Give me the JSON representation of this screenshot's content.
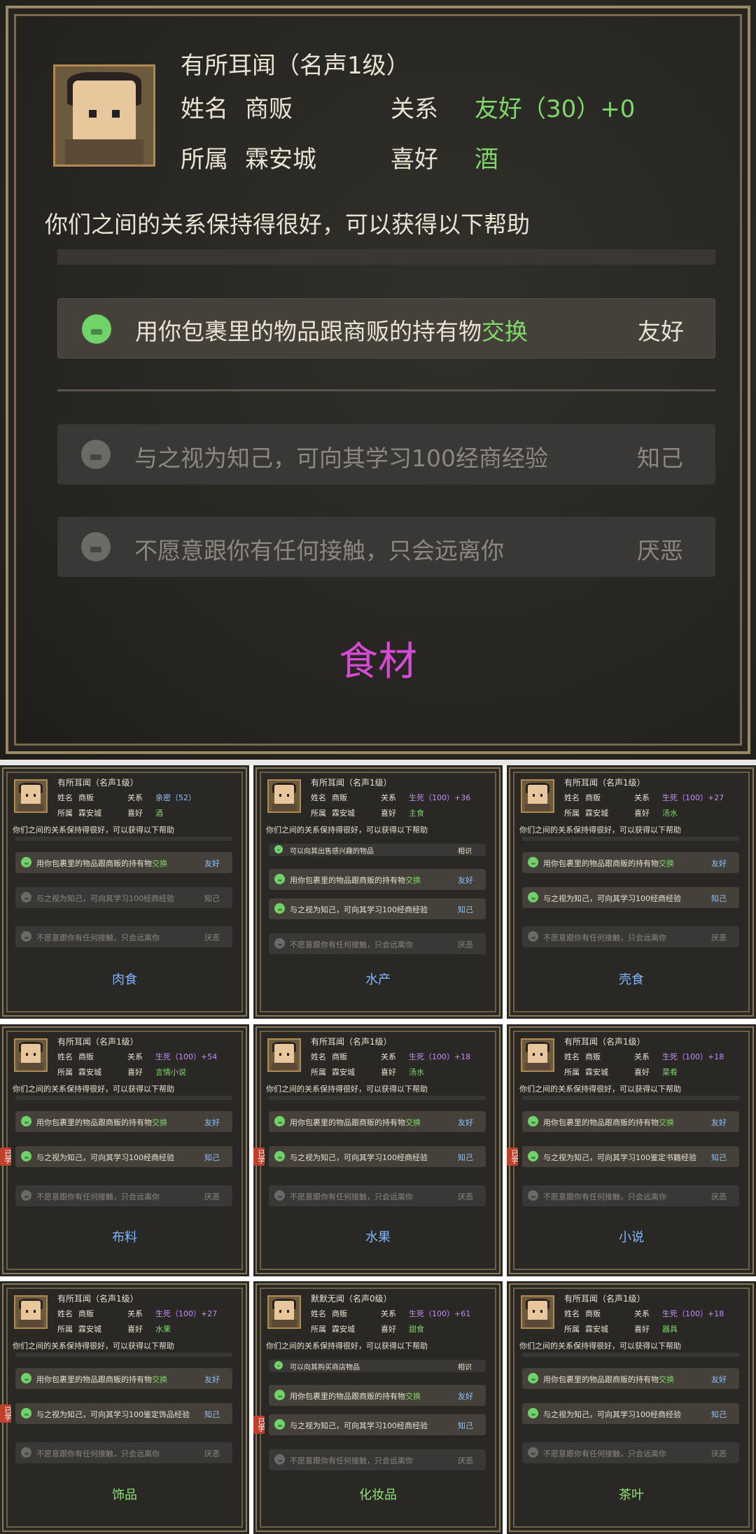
{
  "main": {
    "title": "有所耳闻（名声1级）",
    "name_label": "姓名",
    "name": "商贩",
    "relation_label": "关系",
    "relation": "友好（30）+0",
    "belong_label": "所属",
    "belong": "霖安城",
    "like_label": "喜好",
    "like": "酒",
    "intro": "你们之间的关系保持得很好，可以获得以下帮助",
    "rows": [
      {
        "text_a": "用你包裹里的物品跟商贩的持有物",
        "text_b": "交换",
        "level": "友好",
        "state": "on"
      },
      {
        "text_a": "与之视为知己，可向其学习100经商经验",
        "text_b": "",
        "level": "知己",
        "state": "off"
      },
      {
        "text_a": "不愿意跟你有任何接触，只会远离你",
        "text_b": "",
        "level": "厌恶",
        "state": "off"
      }
    ],
    "caption": "食材",
    "caption_color": "#d64ad6"
  },
  "cards": [
    {
      "title": "有所耳闻（名声1级）",
      "relation": "亲密（52）",
      "relation_color": "#8ec3ff",
      "like": "酒",
      "rows": [
        {
          "a": "用你包裹里的物品跟商贩的持有物",
          "b": "交换",
          "lv": "友好",
          "st": "on",
          "badge": ""
        },
        {
          "a": "与之视为知己，可向其学习100经商经验",
          "b": "",
          "lv": "知己",
          "st": "off",
          "badge": ""
        },
        {
          "a": "不愿意跟你有任何接触，只会远离你",
          "b": "",
          "lv": "厌恶",
          "st": "off",
          "badge": ""
        }
      ],
      "top_strip": "",
      "caption": "肉食",
      "caption_color": "#7fb6ff"
    },
    {
      "title": "有所耳闻（名声1级）",
      "relation": "生死（100）+36",
      "relation_color": "#c68cff",
      "like": "主食",
      "rows": [
        {
          "a": "用你包裹里的物品跟商贩的持有物",
          "b": "交换",
          "lv": "友好",
          "st": "on",
          "badge": ""
        },
        {
          "a": "与之视为知己，可向其学习100经商经验",
          "b": "",
          "lv": "知己",
          "st": "on",
          "badge": ""
        },
        {
          "a": "不愿意跟你有任何接触，只会远离你",
          "b": "",
          "lv": "厌恶",
          "st": "off",
          "badge": ""
        }
      ],
      "top_strip": "可以向其出售感兴趣的物品",
      "caption": "水产",
      "caption_color": "#7fb6ff"
    },
    {
      "title": "有所耳闻（名声1级）",
      "relation": "生死（100）+27",
      "relation_color": "#c68cff",
      "like": "汤水",
      "rows": [
        {
          "a": "用你包裹里的物品跟商贩的持有物",
          "b": "交换",
          "lv": "友好",
          "st": "on",
          "badge": ""
        },
        {
          "a": "与之视为知己，可向其学习100经商经验",
          "b": "",
          "lv": "知己",
          "st": "on",
          "badge": ""
        },
        {
          "a": "不愿意跟你有任何接触，只会远离你",
          "b": "",
          "lv": "厌恶",
          "st": "off",
          "badge": ""
        }
      ],
      "top_strip": "",
      "caption": "壳食",
      "caption_color": "#7fb6ff"
    },
    {
      "title": "有所耳闻（名声1级）",
      "relation": "生死（100）+54",
      "relation_color": "#c68cff",
      "like": "言情小说",
      "rows": [
        {
          "a": "用你包裹里的物品跟商贩的持有物",
          "b": "交换",
          "lv": "友好",
          "st": "on",
          "badge": ""
        },
        {
          "a": "与之视为知己，可向其学习100经商经验",
          "b": "",
          "lv": "知己",
          "st": "on",
          "badge": "已学"
        },
        {
          "a": "不愿意跟你有任何接触，只会远离你",
          "b": "",
          "lv": "厌恶",
          "st": "off",
          "badge": ""
        }
      ],
      "top_strip": "",
      "caption": "布料",
      "caption_color": "#7fb6ff"
    },
    {
      "title": "有所耳闻（名声1级）",
      "relation": "生死（100）+18",
      "relation_color": "#c68cff",
      "like": "汤水",
      "rows": [
        {
          "a": "用你包裹里的物品跟商贩的持有物",
          "b": "交换",
          "lv": "友好",
          "st": "on",
          "badge": ""
        },
        {
          "a": "与之视为知己，可向其学习100经商经验",
          "b": "",
          "lv": "知己",
          "st": "on",
          "badge": "已学"
        },
        {
          "a": "不愿意跟你有任何接触，只会远离你",
          "b": "",
          "lv": "厌恶",
          "st": "off",
          "badge": ""
        }
      ],
      "top_strip": "",
      "caption": "水果",
      "caption_color": "#7fb6ff"
    },
    {
      "title": "有所耳闻（名声1级）",
      "relation": "生死（100）+18",
      "relation_color": "#c68cff",
      "like": "菜肴",
      "rows": [
        {
          "a": "用你包裹里的物品跟商贩的持有物",
          "b": "交换",
          "lv": "友好",
          "st": "on",
          "badge": ""
        },
        {
          "a": "与之视为知己，可向其学习100鉴定书籍经验",
          "b": "",
          "lv": "知己",
          "st": "on",
          "badge": "已学"
        },
        {
          "a": "不愿意跟你有任何接触，只会远离你",
          "b": "",
          "lv": "厌恶",
          "st": "off",
          "badge": ""
        }
      ],
      "top_strip": "",
      "caption": "小说",
      "caption_color": "#7fb6ff"
    },
    {
      "title": "有所耳闻（名声1级）",
      "relation": "生死（100）+27",
      "relation_color": "#c68cff",
      "like": "水果",
      "rows": [
        {
          "a": "用你包裹里的物品跟商贩的持有物",
          "b": "交换",
          "lv": "友好",
          "st": "on",
          "badge": ""
        },
        {
          "a": "与之视为知己，可向其学习100鉴定饰品经验",
          "b": "",
          "lv": "知己",
          "st": "on",
          "badge": "已学"
        },
        {
          "a": "不愿意跟你有任何接触，只会远离你",
          "b": "",
          "lv": "厌恶",
          "st": "off",
          "badge": ""
        }
      ],
      "top_strip": "",
      "caption": "饰品",
      "caption_color": "#8fe27a"
    },
    {
      "title": "默默无闻（名声0级）",
      "relation": "生死（100）+61",
      "relation_color": "#c68cff",
      "like": "甜食",
      "rows": [
        {
          "a": "用你包裹里的物品跟商贩的持有物",
          "b": "交换",
          "lv": "友好",
          "st": "on",
          "badge": ""
        },
        {
          "a": "与之视为知己，可向其学习100经商经验",
          "b": "",
          "lv": "知己",
          "st": "on",
          "badge": "已学"
        },
        {
          "a": "不愿意跟你有任何接触，只会远离你",
          "b": "",
          "lv": "厌恶",
          "st": "off",
          "badge": ""
        }
      ],
      "top_strip": "可以向其购买商店物品",
      "caption": "化妆品",
      "caption_color": "#8fe27a"
    },
    {
      "title": "有所耳闻（名声1级）",
      "relation": "生死（100）+18",
      "relation_color": "#c68cff",
      "like": "器具",
      "rows": [
        {
          "a": "用你包裹里的物品跟商贩的持有物",
          "b": "交换",
          "lv": "友好",
          "st": "on",
          "badge": ""
        },
        {
          "a": "与之视为知己，可向其学习100经商经验",
          "b": "",
          "lv": "知己",
          "st": "on",
          "badge": ""
        },
        {
          "a": "不愿意跟你有任何接触，只会远离你",
          "b": "",
          "lv": "厌恶",
          "st": "off",
          "badge": ""
        }
      ],
      "top_strip": "",
      "caption": "茶叶",
      "caption_color": "#8fe27a"
    }
  ],
  "card_labels": {
    "name_label": "姓名",
    "name": "商贩",
    "relation_label": "关系",
    "belong_label": "所属",
    "belong": "霖安城",
    "like_label": "喜好",
    "intro": "你们之间的关系保持得很好，可以获得以下帮助",
    "strip_level": "相识"
  }
}
